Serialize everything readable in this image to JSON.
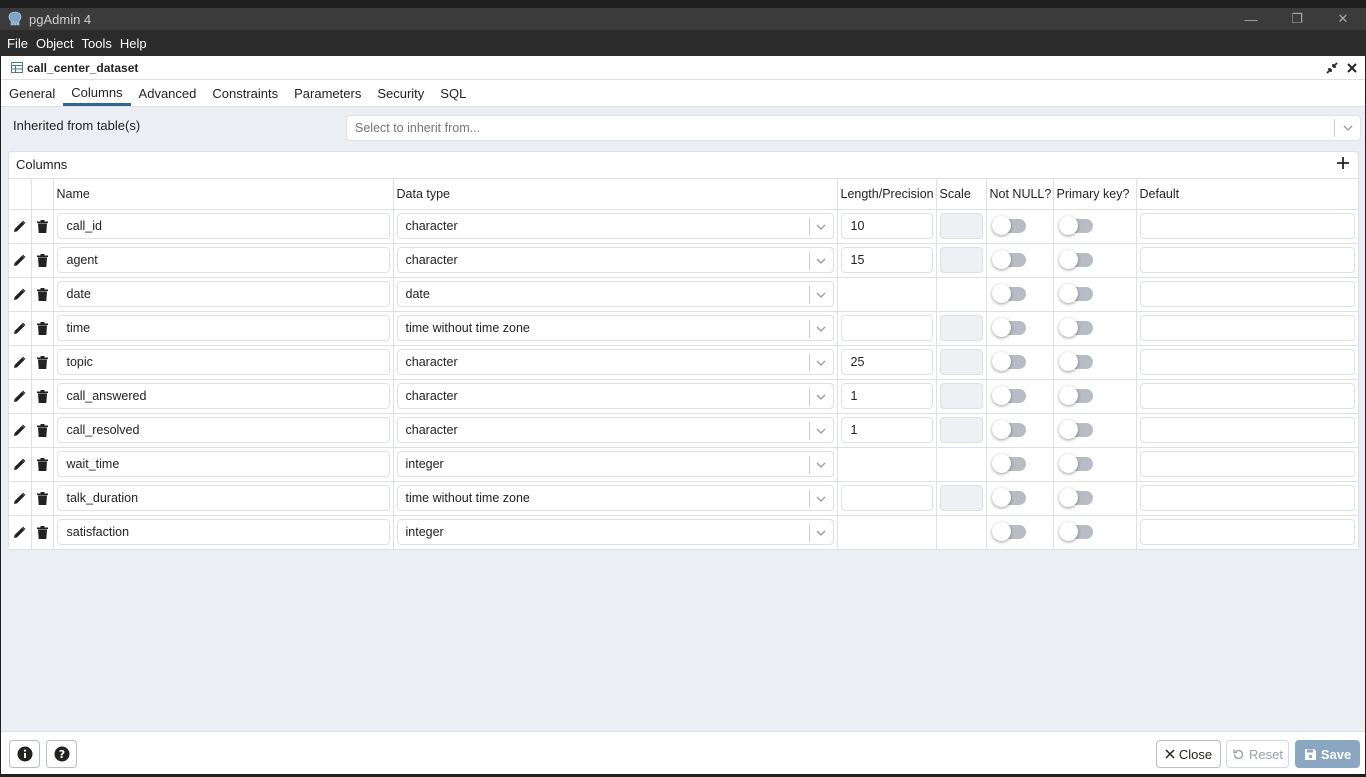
{
  "window": {
    "title": "pgAdmin 4"
  },
  "menu": [
    "File",
    "Object",
    "Tools",
    "Help"
  ],
  "panel": {
    "title": "call_center_dataset"
  },
  "tabs": [
    {
      "label": "General"
    },
    {
      "label": "Columns"
    },
    {
      "label": "Advanced"
    },
    {
      "label": "Constraints"
    },
    {
      "label": "Parameters"
    },
    {
      "label": "Security"
    },
    {
      "label": "SQL"
    }
  ],
  "active_tab": "Columns",
  "inherit": {
    "label": "Inherited from table(s)",
    "placeholder": "Select to inherit from..."
  },
  "columns_section": {
    "title": "Columns",
    "headers": {
      "name": "Name",
      "data_type": "Data type",
      "length": "Length/Precision",
      "scale": "Scale",
      "not_null": "Not NULL?",
      "primary_key": "Primary key?",
      "default": "Default"
    },
    "rows": [
      {
        "name": "call_id",
        "type": "character",
        "length": "10",
        "length_editable": true,
        "scale_editable": true
      },
      {
        "name": "agent",
        "type": "character",
        "length": "15",
        "length_editable": true,
        "scale_editable": true
      },
      {
        "name": "date",
        "type": "date",
        "length": "",
        "length_editable": false,
        "scale_editable": false
      },
      {
        "name": "time",
        "type": "time without time zone",
        "length": "",
        "length_editable": true,
        "scale_editable": true
      },
      {
        "name": "topic",
        "type": "character",
        "length": "25",
        "length_editable": true,
        "scale_editable": true
      },
      {
        "name": "call_answered",
        "type": "character",
        "length": "1",
        "length_editable": true,
        "scale_editable": true
      },
      {
        "name": "call_resolved",
        "type": "character",
        "length": "1",
        "length_editable": true,
        "scale_editable": true
      },
      {
        "name": "wait_time",
        "type": "integer",
        "length": "",
        "length_editable": false,
        "scale_editable": false
      },
      {
        "name": "talk_duration",
        "type": "time without time zone",
        "length": "",
        "length_editable": true,
        "scale_editable": true
      },
      {
        "name": "satisfaction",
        "type": "integer",
        "length": "",
        "length_editable": false,
        "scale_editable": false
      }
    ]
  },
  "footer": {
    "close": "Close",
    "reset": "Reset",
    "save": "Save"
  },
  "colors": {
    "accent": "#326690",
    "save_button": "#8aa6c0"
  }
}
